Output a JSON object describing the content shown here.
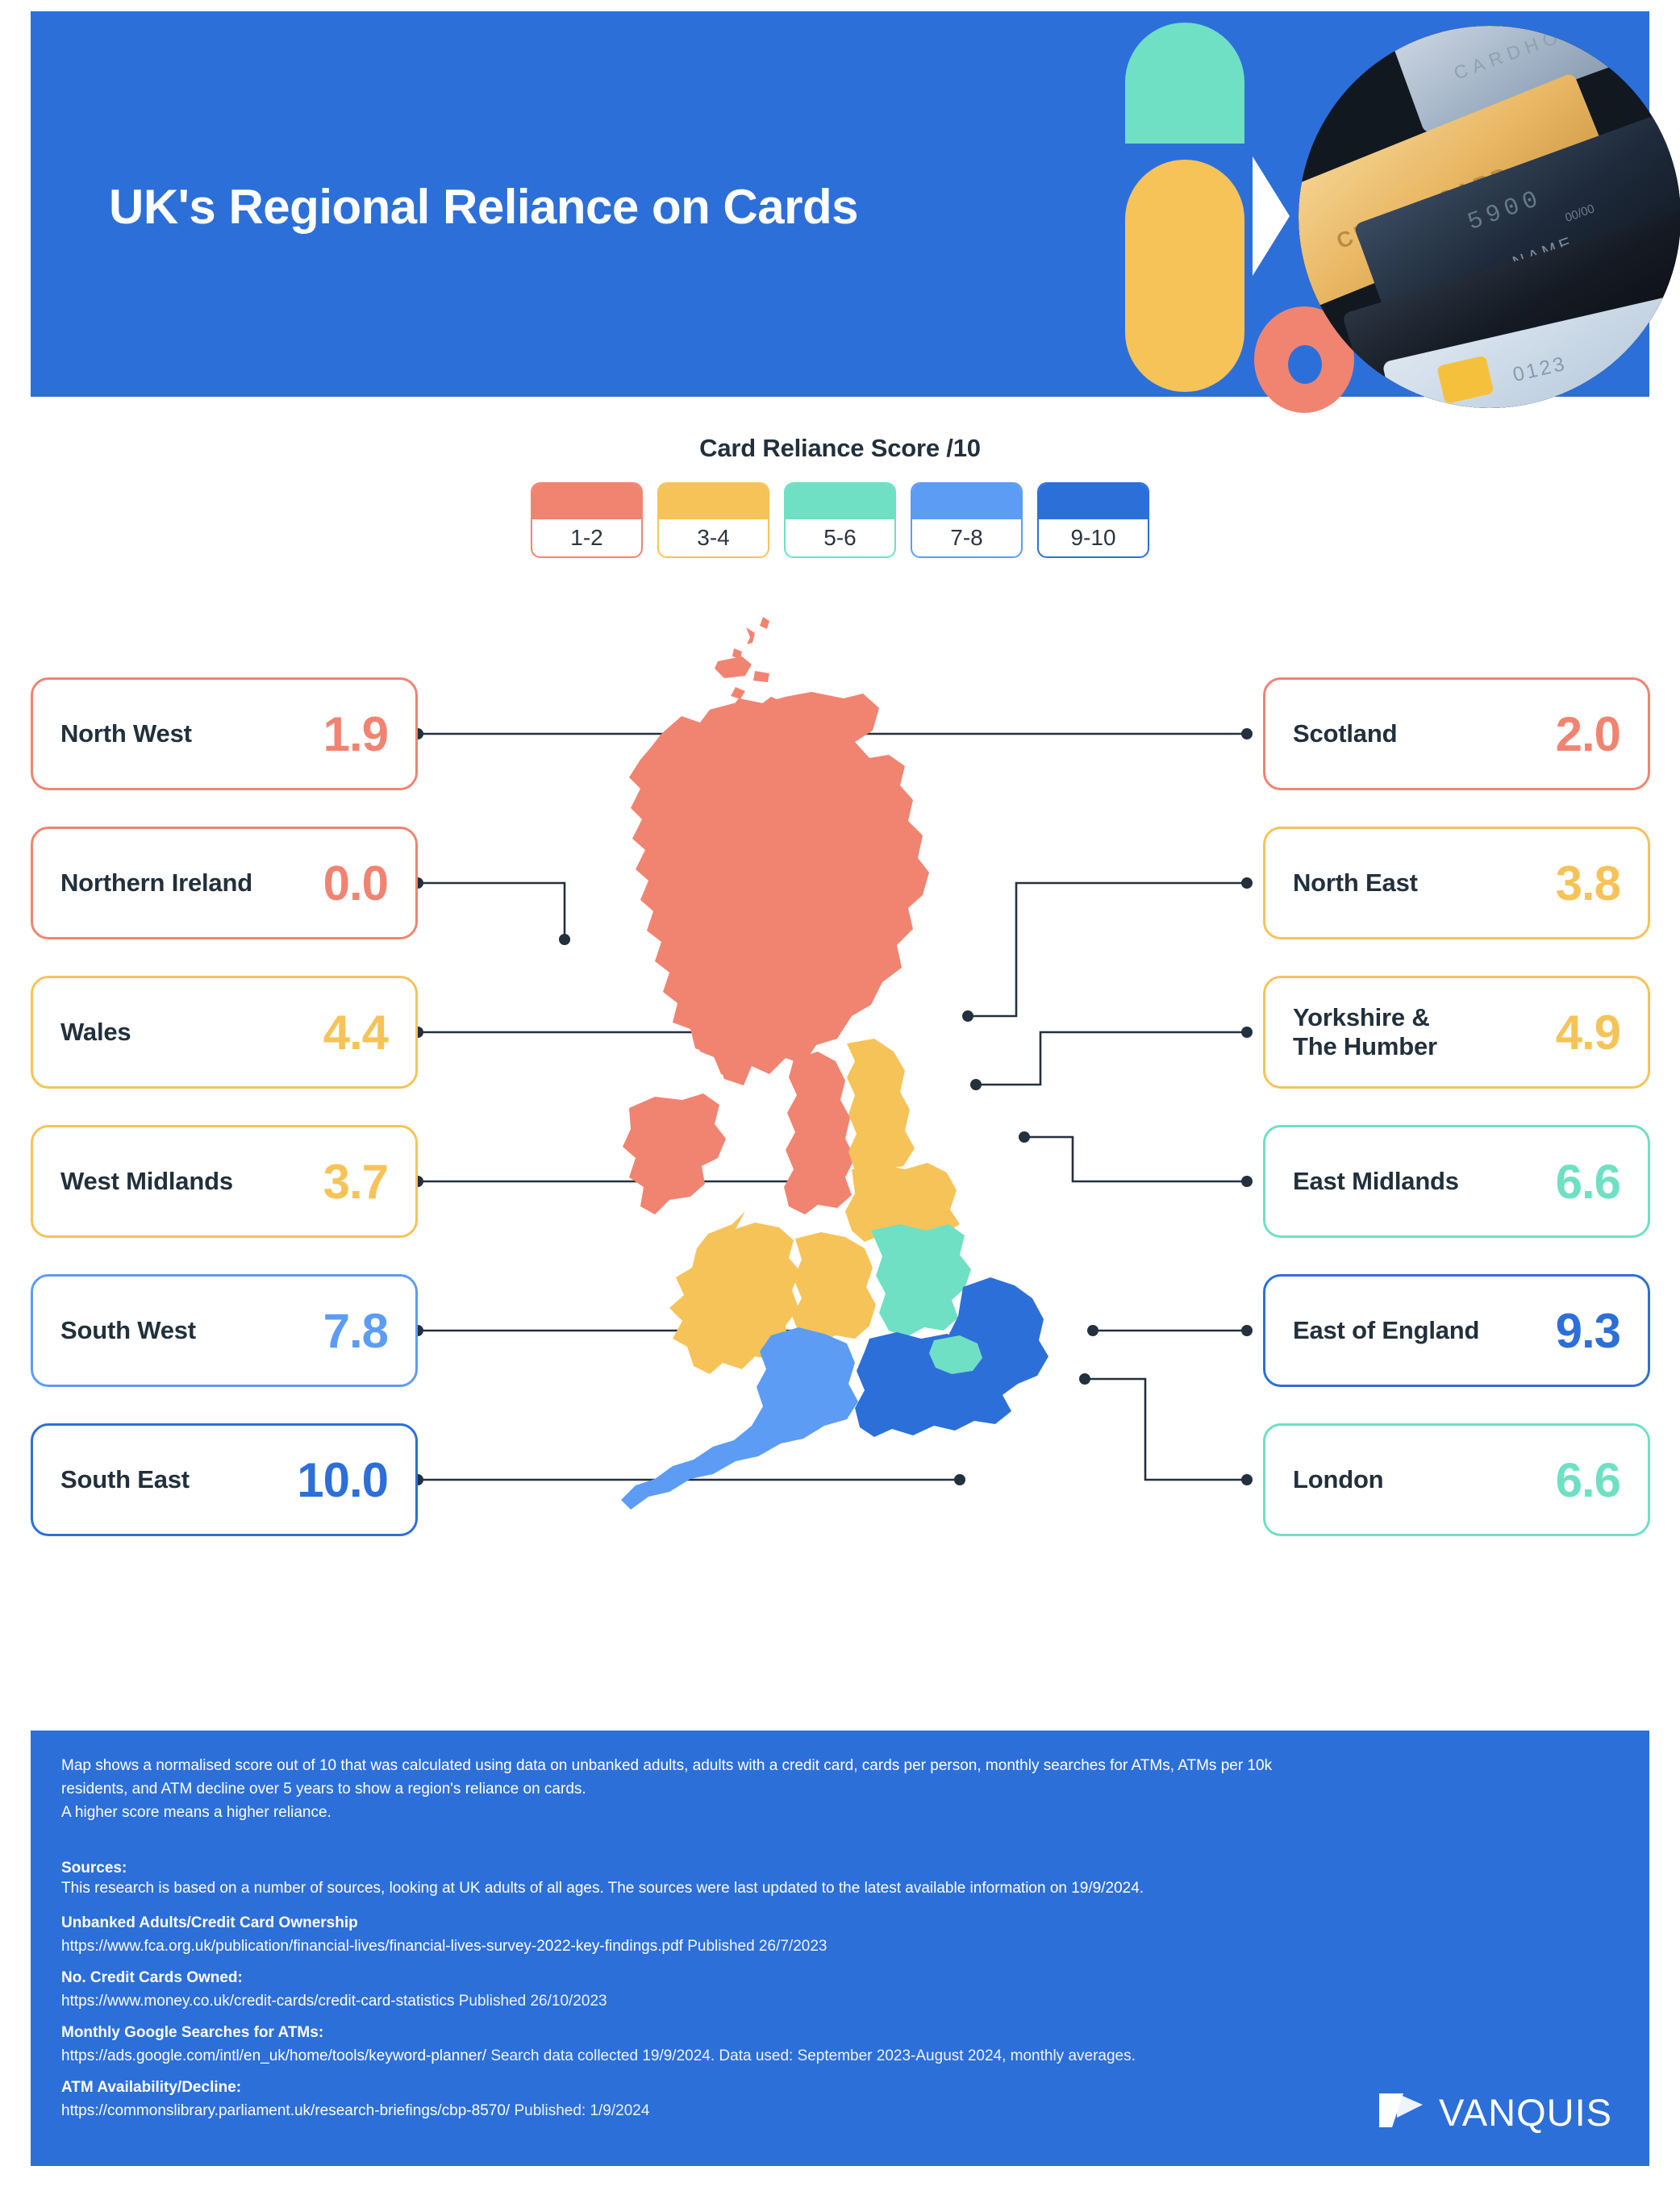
{
  "header": {
    "title": "UK's Regional Reliance on Cards",
    "background_color": "#2D6FD9",
    "decorations": [
      "teal-arch",
      "yellow-pill",
      "white-triangle",
      "coral-donut",
      "credit-cards-photo"
    ]
  },
  "legend": {
    "title": "Card Reliance Score /10",
    "items": [
      {
        "label": "1-2",
        "color": "#F08471"
      },
      {
        "label": "3-4",
        "color": "#F6C359"
      },
      {
        "label": "5-6",
        "color": "#6FE0C4"
      },
      {
        "label": "7-8",
        "color": "#5C9CF5"
      },
      {
        "label": "9-10",
        "color": "#2D6FD9"
      }
    ]
  },
  "chart_data": {
    "type": "map",
    "title": "UK's Regional Reliance on Cards",
    "value_label": "Card Reliance Score /10",
    "range": [
      0,
      10
    ],
    "categories": [
      "North West",
      "Northern Ireland",
      "Wales",
      "West Midlands",
      "South West",
      "South East",
      "Scotland",
      "North East",
      "Yorkshire & The Humber",
      "East Midlands",
      "East of England",
      "London"
    ],
    "values": [
      1.9,
      0.0,
      4.4,
      3.7,
      7.8,
      10.0,
      2.0,
      3.8,
      4.9,
      6.6,
      9.3,
      6.6
    ],
    "legend_bins": [
      "1-2",
      "3-4",
      "5-6",
      "7-8",
      "9-10"
    ],
    "bin_colors": [
      "#F08471",
      "#F6C359",
      "#6FE0C4",
      "#5C9CF5",
      "#2D6FD9"
    ]
  },
  "cards": {
    "left": [
      {
        "name": "North West",
        "score": "1.9",
        "color": "#F08471"
      },
      {
        "name": "Northern Ireland",
        "score": "0.0",
        "color": "#F08471"
      },
      {
        "name": "Wales",
        "score": "4.4",
        "color": "#F6C359"
      },
      {
        "name": "West Midlands",
        "score": "3.7",
        "color": "#F6C359"
      },
      {
        "name": "South West",
        "score": "7.8",
        "color": "#5C9CF5"
      },
      {
        "name": "South East",
        "score": "10.0",
        "color": "#2D6FD9"
      }
    ],
    "right": [
      {
        "name": "Scotland",
        "score": "2.0",
        "color": "#F08471"
      },
      {
        "name": "North East",
        "score": "3.8",
        "color": "#F6C359"
      },
      {
        "name": "Yorkshire &\nThe Humber",
        "score": "4.9",
        "color": "#F6C359"
      },
      {
        "name": "East Midlands",
        "score": "6.6",
        "color": "#6FE0C4"
      },
      {
        "name": "East of England",
        "score": "9.3",
        "color": "#2D6FD9"
      },
      {
        "name": "London",
        "score": "6.6",
        "color": "#6FE0C4"
      }
    ]
  },
  "footer": {
    "methodology_line1": "Map shows a normalised score out of 10 that was calculated using data on unbanked adults, adults with a credit card, cards per person, monthly searches for ATMs, ATMs per 10k",
    "methodology_line2": "residents, and ATM decline over 5 years to show a region's reliance on cards.",
    "methodology_line3": "A higher score means a higher reliance.",
    "sources_heading": "Sources:",
    "sources_intro": "This research is based on a number of sources, looking at UK adults of all ages. The sources were last updated to the latest available information on 19/9/2024.",
    "entries": [
      {
        "heading": "Unbanked Adults/Credit Card Ownership",
        "url": "https://www.fca.org.uk/publication/financial-lives/financial-lives-survey-2022-key-findings.pdf",
        "note": "Published 26/7/2023"
      },
      {
        "heading": "No. Credit Cards Owned:",
        "url": "https://www.money.co.uk/credit-cards/credit-card-statistics",
        "note": "Published 26/10/2023"
      },
      {
        "heading": "Monthly Google Searches for ATMs:",
        "url": "https://ads.google.com/intl/en_uk/home/tools/keyword-planner/",
        "note": "Search data collected 19/9/2024. Data used: September 2023-August 2024, monthly averages."
      },
      {
        "heading": "ATM Availability/Decline:",
        "url": "https://commonslibrary.parliament.uk/research-briefings/cbp-8570/",
        "note": "Published: 1/9/2024"
      }
    ],
    "logo_text": "VANQUIS"
  }
}
